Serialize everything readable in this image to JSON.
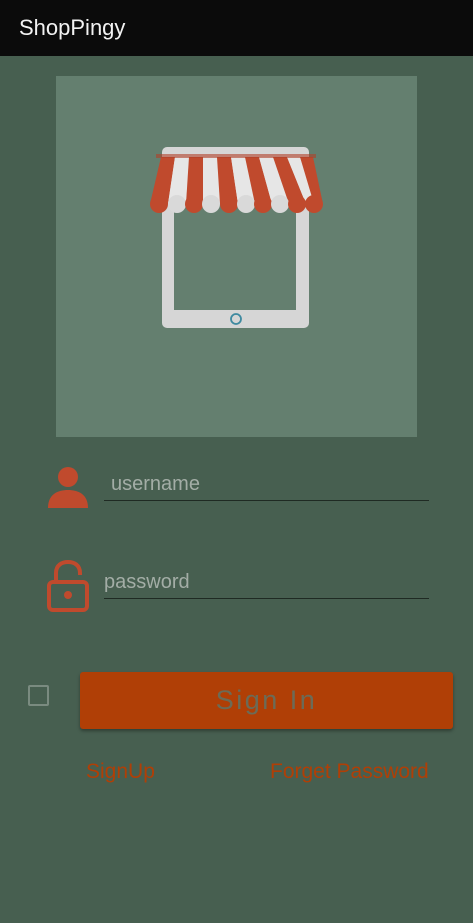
{
  "app_bar": {
    "title": "ShopPingy"
  },
  "logo": {
    "icon": "storefront-tablet-icon",
    "bg_color": "#647f6f"
  },
  "login_form": {
    "username": {
      "icon": "person-icon",
      "placeholder": "username",
      "value": ""
    },
    "password": {
      "icon": "unlock-icon",
      "placeholder": "password",
      "value": ""
    },
    "remember_checkbox": {
      "checked": false
    },
    "sign_in_label": "Sign In"
  },
  "links": {
    "signup": "SignUp",
    "forget_password": "Forget Password"
  },
  "colors": {
    "accent": "#b03f06",
    "background": "#475f50",
    "app_bar": "#0b0b0b"
  }
}
